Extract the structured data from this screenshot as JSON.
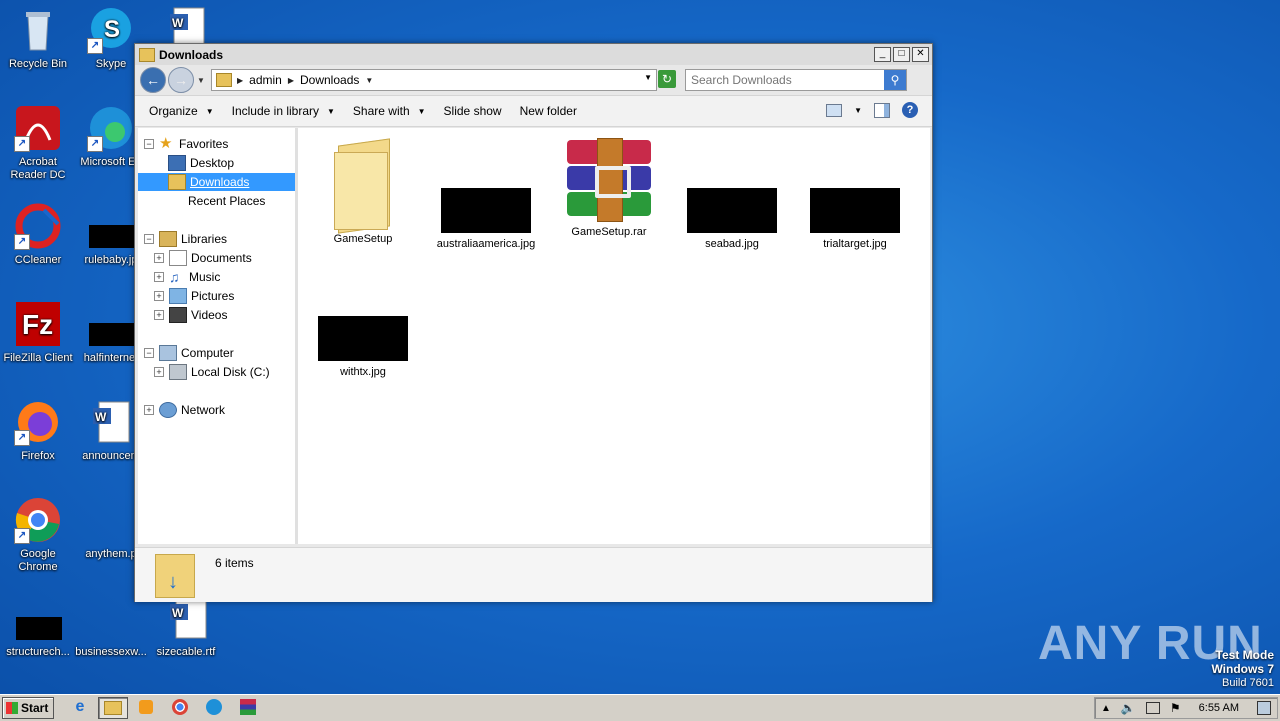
{
  "desktop": {
    "icons": [
      {
        "label": "Recycle Bin"
      },
      {
        "label": "Skype"
      },
      {
        "label": "Acrobat Reader DC"
      },
      {
        "label": "Microsoft Ed"
      },
      {
        "label": "CCleaner"
      },
      {
        "label": "rulebaby.jp"
      },
      {
        "label": "FileZilla Client"
      },
      {
        "label": "halfinternet"
      },
      {
        "label": "Firefox"
      },
      {
        "label": "announcem"
      },
      {
        "label": "Google Chrome"
      },
      {
        "label": "anythem.p"
      },
      {
        "label": "structurech..."
      },
      {
        "label": "businessexw..."
      },
      {
        "label": "sizecable.rtf"
      }
    ]
  },
  "window": {
    "title": "Downloads",
    "controls": {
      "minimize": "_",
      "maximize": "□",
      "close": "✕"
    },
    "breadcrumb": [
      "admin",
      "Downloads"
    ],
    "search": {
      "placeholder": "Search Downloads"
    },
    "toolbar": {
      "organize": "Organize",
      "include": "Include in library",
      "share": "Share with",
      "slideshow": "Slide show",
      "newfolder": "New folder"
    },
    "nav": {
      "favorites": "Favorites",
      "desktop": "Desktop",
      "downloads": "Downloads",
      "recent": "Recent Places",
      "libraries": "Libraries",
      "documents": "Documents",
      "music": "Music",
      "pictures": "Pictures",
      "videos": "Videos",
      "computer": "Computer",
      "localdisk": "Local Disk (C:)",
      "network": "Network"
    },
    "files": [
      {
        "name": "GameSetup",
        "icon": "folder-icon"
      },
      {
        "name": "australiaamerica.jpg",
        "icon": "image-thumbnail"
      },
      {
        "name": "GameSetup.rar",
        "icon": "winrar-icon"
      },
      {
        "name": "seabad.jpg",
        "icon": "image-thumbnail"
      },
      {
        "name": "trialtarget.jpg",
        "icon": "image-thumbnail"
      },
      {
        "name": "withtx.jpg",
        "icon": "image-thumbnail"
      }
    ],
    "status": {
      "count": "6 items"
    }
  },
  "taskbar": {
    "start": "Start",
    "clock": "6:55 AM"
  },
  "watermark": {
    "brand": "ANY RUN",
    "mode": "Test Mode",
    "os": "Windows 7",
    "build": "Build 7601"
  },
  "colors": {
    "selection": "#3399ff",
    "desktop": "#1669c9"
  }
}
